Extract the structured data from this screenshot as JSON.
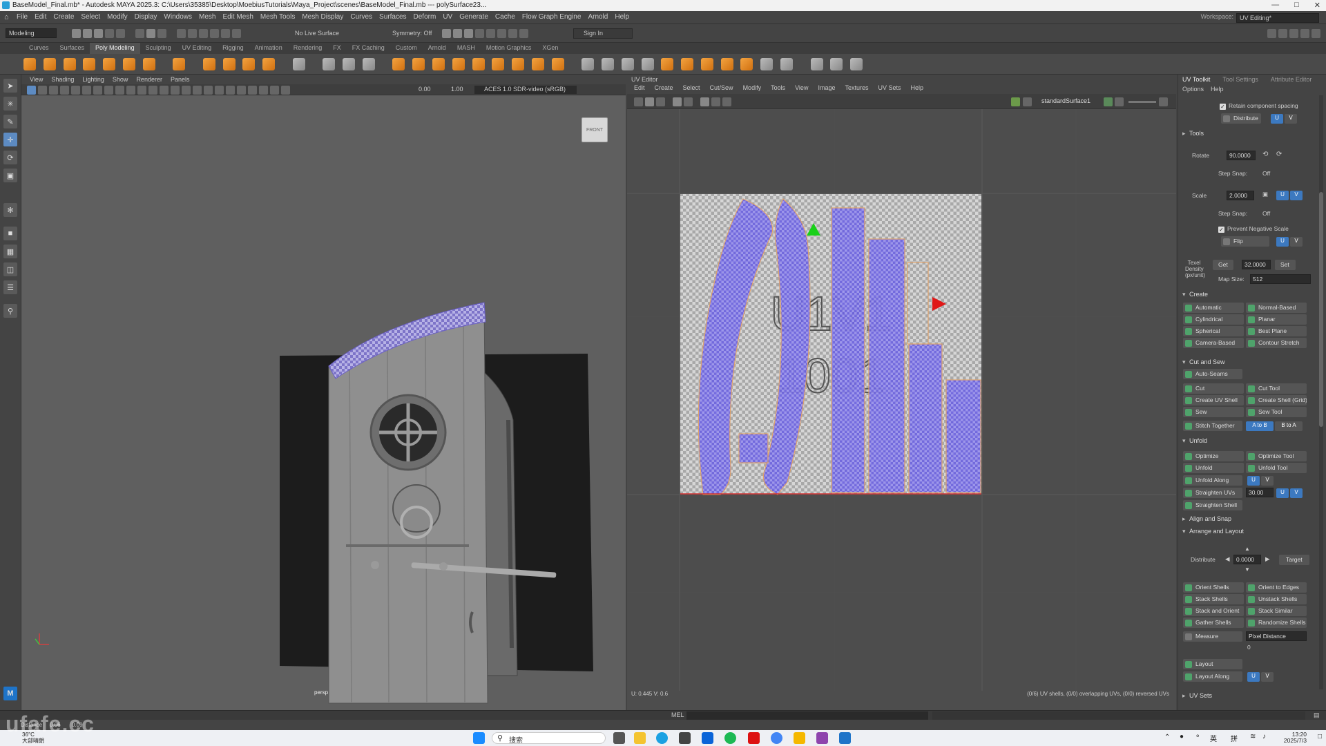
{
  "title_bar": {
    "text": "BaseModel_Final.mb* - Autodesk MAYA 2025.3: C:\\Users\\35385\\Desktop\\MoebiusTutorials\\Maya_Project\\scenes\\BaseModel_Final.mb  ---  polySurface23..."
  },
  "menu": {
    "items": [
      "File",
      "Edit",
      "Create",
      "Select",
      "Modify",
      "Display",
      "Windows",
      "Mesh",
      "Edit Mesh",
      "Mesh Tools",
      "Mesh Display",
      "Curves",
      "Surfaces",
      "Deform",
      "UV",
      "Generate",
      "Cache",
      "Flow Graph Engine",
      "Arnold",
      "Help"
    ],
    "workspace_label": "Workspace:",
    "workspace_value": "UV Editing*"
  },
  "status": {
    "mode": "Modeling",
    "live_surface": "No Live Surface",
    "symmetry": "Symmetry: Off",
    "sign_in": "Sign In"
  },
  "shelf_tabs": [
    "Curves",
    "Surfaces",
    "Poly Modeling",
    "Sculpting",
    "UV Editing",
    "Rigging",
    "Animation",
    "Rendering",
    "FX",
    "FX Caching",
    "Custom",
    "Arnold",
    "MASH",
    "Motion Graphics",
    "XGen"
  ],
  "shelf_active": "Poly Modeling",
  "viewport": {
    "menus": [
      "View",
      "Shading",
      "Lighting",
      "Show",
      "Renderer",
      "Panels"
    ],
    "field_a": "0.00",
    "field_b": "1.00",
    "colorspace": "ACES 1.0 SDR-video (sRGB)",
    "cube_label": "FRONT",
    "camera": "persp"
  },
  "uv_editor": {
    "title": "UV Editor",
    "menus": [
      "Edit",
      "Create",
      "Select",
      "Cut/Sew",
      "Modify",
      "Tools",
      "View",
      "Image",
      "Textures",
      "UV Sets",
      "Help"
    ],
    "shape": "standardSurface1",
    "tile_label_line1": "U1V1",
    "tile_label_line2": "1001",
    "coords": "U: 0.445 V: 0.6",
    "summary": "(0/6) UV shells, (0/0) overlapping UVs, (0/0) reversed UVs"
  },
  "toolkit": {
    "tabs": [
      "UV Toolkit",
      "Tool Settings",
      "Attribute Editor"
    ],
    "menus": [
      "Options",
      "Help"
    ],
    "retain_spacing": "Retain component spacing",
    "distribute_top": "Distribute",
    "tools_section": "Tools",
    "rotate_label": "Rotate",
    "rotate_value": "90.0000",
    "step_snap_label": "Step Snap:",
    "step_snap_value": "Off",
    "scale_label": "Scale",
    "scale_value": "2.0000",
    "prevent_negative": "Prevent Negative Scale",
    "flip": "Flip",
    "texel_label": "Texel Density (px/unit)",
    "get": "Get",
    "texel_value": "32.0000",
    "set": "Set",
    "map_size_label": "Map Size:",
    "map_size_value": "512",
    "create_section": "Create",
    "create_buttons": [
      "Automatic",
      "Normal-Based",
      "Cylindrical",
      "Planar",
      "Spherical",
      "Best Plane",
      "Camera-Based",
      "Contour Stretch"
    ],
    "cut_section": "Cut and Sew",
    "auto_seams": "Auto-Seams",
    "cut_buttons": [
      "Cut",
      "Cut Tool",
      "Create UV Shell",
      "Create Shell (Grid)",
      "Sew",
      "Sew Tool"
    ],
    "stitch": "Stitch Together",
    "a_to_b": "A to B",
    "b_to_a": "B to A",
    "unfold_section": "Unfold",
    "unfold_buttons": [
      "Optimize",
      "Optimize Tool",
      "Unfold",
      "Unfold Tool"
    ],
    "unfold_along": "Unfold Along",
    "straighten_uvs": "Straighten UVs",
    "straighten_value": "30.00",
    "straighten_shell": "Straighten Shell",
    "align_section": "Align and Snap",
    "arrange_section": "Arrange and Layout",
    "distribute_label": "Distribute",
    "distribute_value": "0.0000",
    "target": "Target",
    "arrange_buttons": [
      "Orient Shells",
      "Orient to Edges",
      "Stack Shells",
      "Unstack Shells",
      "Stack and Orient",
      "Stack Similar",
      "Gather Shells",
      "Randomize Shells"
    ],
    "measure": "Measure",
    "measure_mode": "Pixel Distance",
    "measure_value": "0",
    "layout": "Layout",
    "layout_along": "Layout Along",
    "uvsets_section": "UV Sets",
    "u": "U",
    "v": "V"
  },
  "command": {
    "label": "MEL"
  },
  "help": {
    "distance_label": "Distance",
    "distance_a": "0.06",
    "distance_b": "0.09"
  },
  "taskbar": {
    "search": "搜索",
    "weather_temp": "36°C",
    "weather_desc": "大部晴朗",
    "ime": "英",
    "ime2": "拼",
    "time": "13:20",
    "date": "2025/7/3"
  },
  "watermark": "ufafe.cc"
}
